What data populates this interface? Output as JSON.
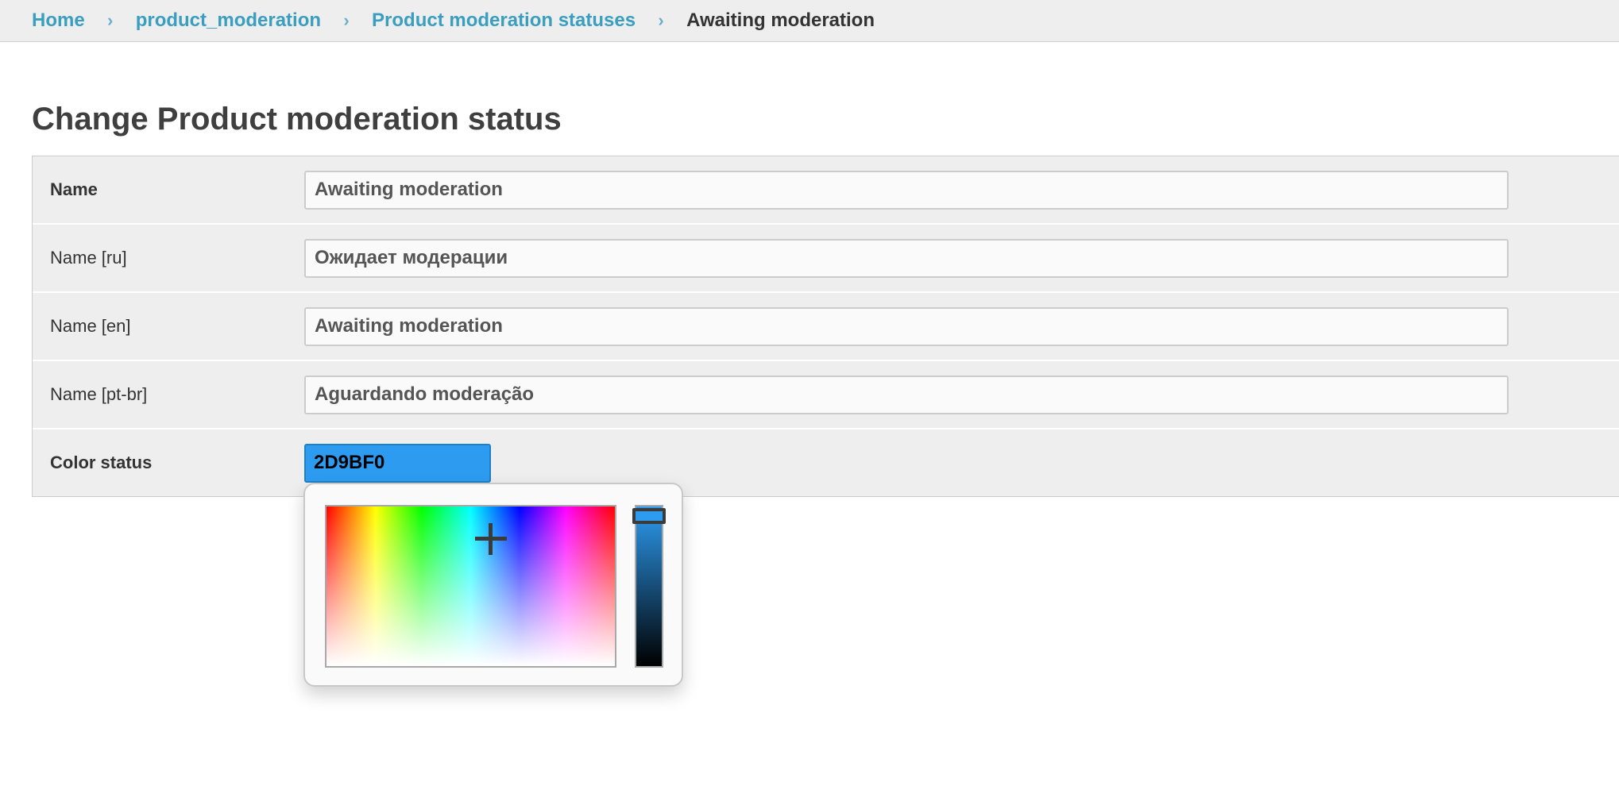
{
  "breadcrumbs": {
    "home": "Home",
    "app": "product_moderation",
    "model": "Product moderation statuses",
    "current": "Awaiting moderation",
    "separator": "›"
  },
  "page": {
    "title": "Change Product moderation status"
  },
  "form": {
    "name": {
      "label": "Name",
      "value": "Awaiting moderation"
    },
    "name_ru": {
      "label": "Name [ru]",
      "value": "Ожидает модерации"
    },
    "name_en": {
      "label": "Name [en]",
      "value": "Awaiting moderation"
    },
    "name_pt_br": {
      "label": "Name [pt-br]",
      "value": "Aguardando moderação"
    },
    "color_status": {
      "label": "Color status",
      "value": "2D9BF0"
    }
  },
  "color_picker": {
    "selected_color": "#2D9BF0",
    "icons": [
      "crosshair-icon",
      "slider-handle-icon"
    ]
  },
  "colors": {
    "link": "#3a9ec0",
    "breadcrumb_bg": "#eeeeee",
    "form_bg": "#eeeeee",
    "selected_color": "#2d9bf0"
  }
}
